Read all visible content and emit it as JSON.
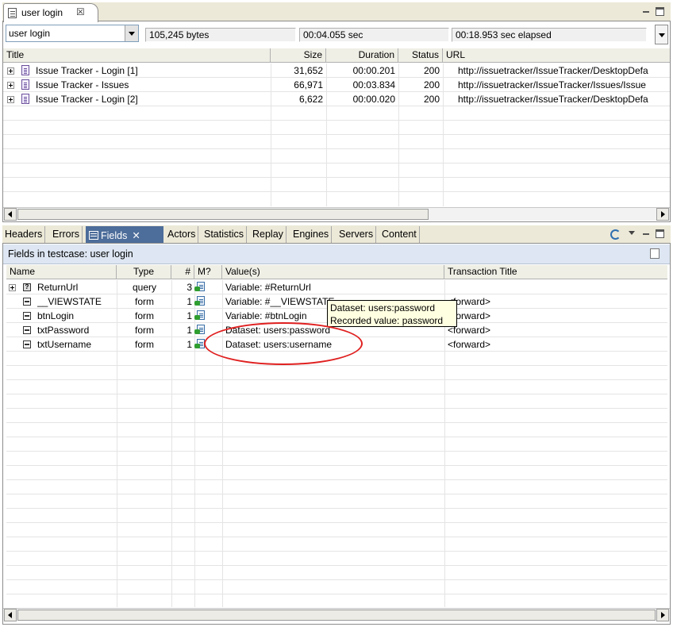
{
  "editor": {
    "tab_title": "user login",
    "tab_close": "☒"
  },
  "toolbar": {
    "testcase_select": "user login",
    "bytes": "105,245 bytes",
    "duration": "00:04.055 sec",
    "elapsed": "00:18.953 sec elapsed"
  },
  "transactions": {
    "columns": [
      "Title",
      "Size",
      "Duration",
      "Status",
      "URL"
    ],
    "rows": [
      {
        "title": "Issue Tracker - Login [1]",
        "size": "31,652",
        "duration": "00:00.201",
        "status": "200",
        "url": "http://issuetracker/IssueTracker/DesktopDefa"
      },
      {
        "title": "Issue Tracker - Issues",
        "size": "66,971",
        "duration": "00:03.834",
        "status": "200",
        "url": "http://issuetracker/IssueTracker/Issues/Issue"
      },
      {
        "title": "Issue Tracker - Login [2]",
        "size": "6,622",
        "duration": "00:00.020",
        "status": "200",
        "url": "http://issuetracker/IssueTracker/DesktopDefa"
      }
    ]
  },
  "view_tabs": {
    "headers": "Headers",
    "errors": "Errors",
    "fields": "Fields",
    "fields_close": "✕",
    "actors": "Actors",
    "statistics": "Statistics",
    "replay": "Replay",
    "engines": "Engines",
    "servers": "Servers",
    "content": "Content"
  },
  "fields_view": {
    "heading": "Fields in testcase: user login",
    "columns": [
      "Name",
      "Type",
      "#",
      "M?",
      "Value(s)",
      "Transaction Title"
    ],
    "rows": [
      {
        "name": "ReturnUrl",
        "type": "query",
        "count": "3",
        "value": "Variable: #ReturnUrl",
        "transaction": ""
      },
      {
        "name": "__VIEWSTATE",
        "type": "form",
        "count": "1",
        "value": "Variable: #__VIEWSTATE",
        "transaction": "<forward>"
      },
      {
        "name": "btnLogin",
        "type": "form",
        "count": "1",
        "value": "Variable: #btnLogin",
        "transaction": "<forward>"
      },
      {
        "name": "txtPassword",
        "type": "form",
        "count": "1",
        "value": "Dataset: users:password",
        "transaction": "<forward>"
      },
      {
        "name": "txtUsername",
        "type": "form",
        "count": "1",
        "value": "Dataset: users:username",
        "transaction": "<forward>"
      }
    ],
    "tooltip": {
      "line1": "Dataset: users:password",
      "line2": "Recorded value: password"
    }
  },
  "colors": {
    "active_tab": "#4d6d9a",
    "annotation": "#e02020",
    "tooltip_bg": "#ffffe1"
  }
}
